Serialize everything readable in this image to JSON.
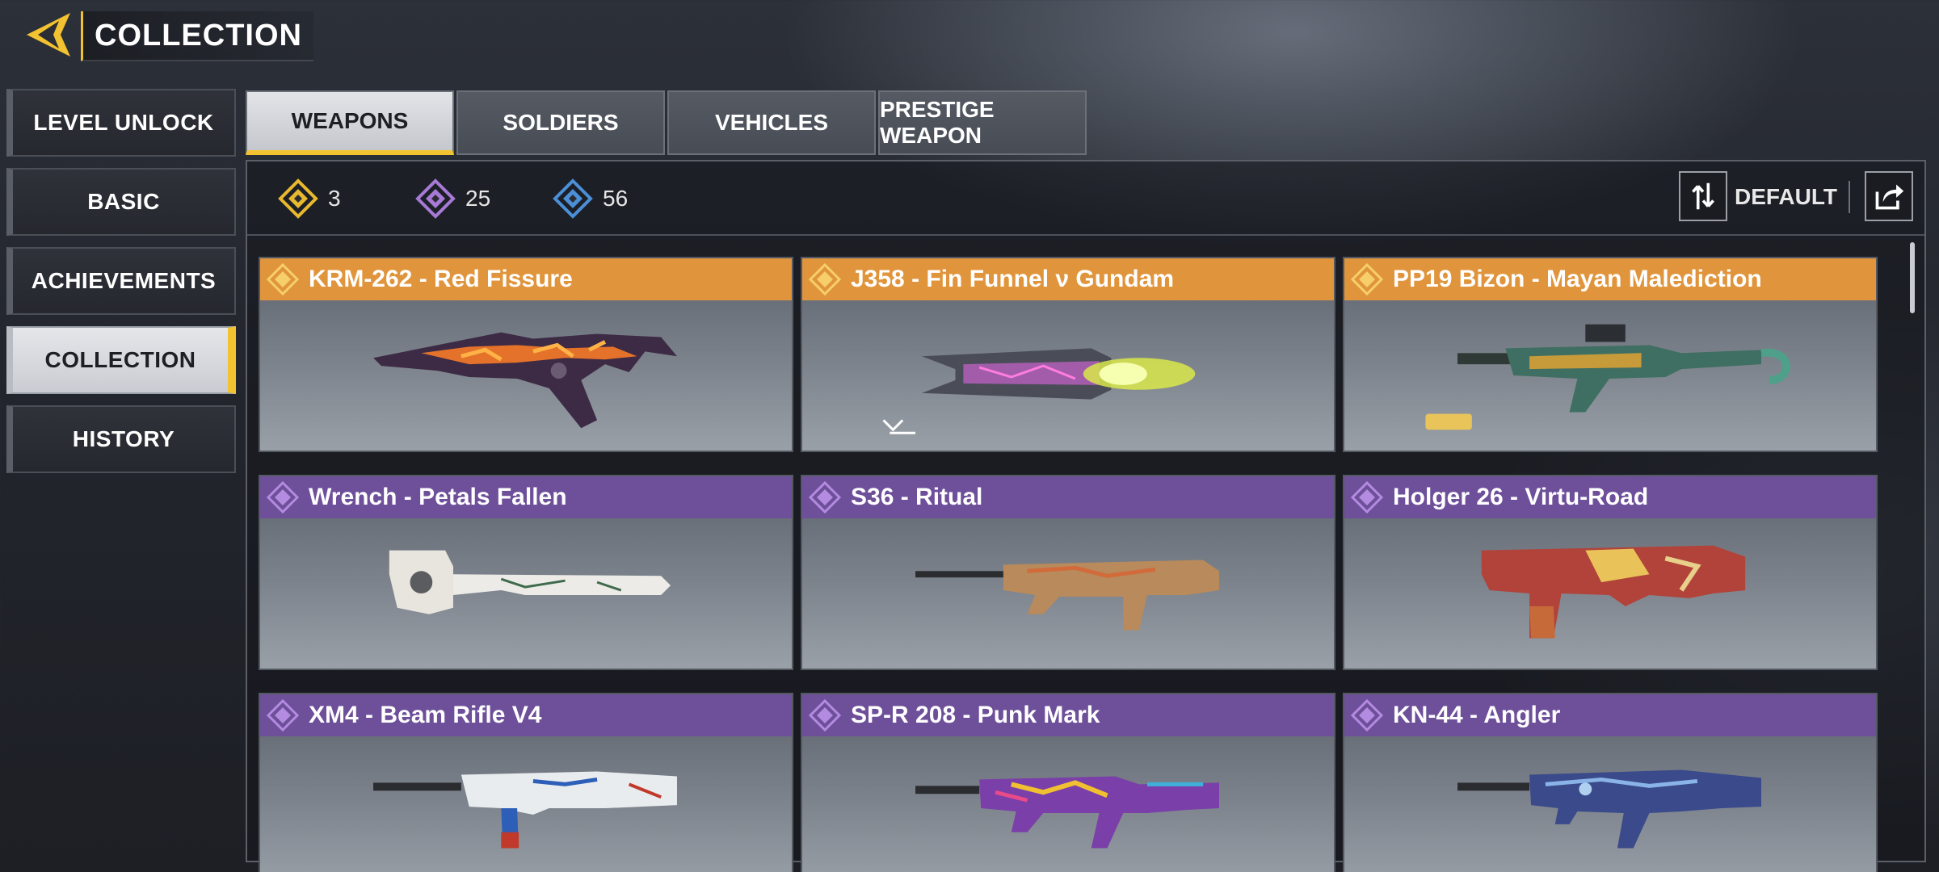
{
  "header": {
    "title": "COLLECTION"
  },
  "sidebar": {
    "items": [
      {
        "label": "LEVEL UNLOCK",
        "active": false
      },
      {
        "label": "BASIC",
        "active": false
      },
      {
        "label": "ACHIEVEMENTS",
        "active": false
      },
      {
        "label": "COLLECTION",
        "active": true
      },
      {
        "label": "HISTORY",
        "active": false
      }
    ]
  },
  "tabs": [
    {
      "label": "WEAPONS",
      "active": true
    },
    {
      "label": "SOLDIERS",
      "active": false
    },
    {
      "label": "VEHICLES",
      "active": false
    },
    {
      "label": "PRESTIGE WEAPON",
      "active": false
    }
  ],
  "stats": [
    {
      "rarity": "legendary",
      "color": "#e8b92f",
      "count": "3"
    },
    {
      "rarity": "epic",
      "color": "#a67ad6",
      "count": "25"
    },
    {
      "rarity": "rare",
      "color": "#4b8fd6",
      "count": "56"
    }
  ],
  "sort": {
    "label": "DEFAULT"
  },
  "items": [
    {
      "name": "KRM-262 - Red Fissure",
      "rarity": "legendary"
    },
    {
      "name": "J358 - Fin Funnel ν Gundam",
      "rarity": "legendary"
    },
    {
      "name": "PP19 Bizon - Mayan Malediction",
      "rarity": "legendary"
    },
    {
      "name": "Wrench - Petals Fallen",
      "rarity": "epic"
    },
    {
      "name": "S36 - Ritual",
      "rarity": "epic"
    },
    {
      "name": "Holger 26 - Virtu-Road",
      "rarity": "epic"
    },
    {
      "name": "XM4 - Beam Rifle V4",
      "rarity": "epic"
    },
    {
      "name": "SP-R 208 -  Punk Mark",
      "rarity": "epic"
    },
    {
      "name": "KN-44 - Angler",
      "rarity": "epic"
    }
  ],
  "colors": {
    "accent": "#f2c230",
    "legendary_header": "#e0953c",
    "epic_header": "#6e4f9a"
  }
}
